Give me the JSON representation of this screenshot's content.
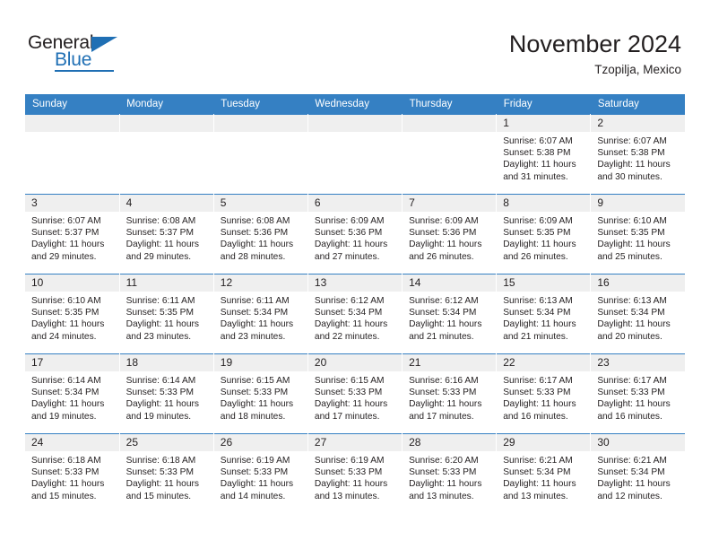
{
  "brand": {
    "name_top": "General",
    "name_bottom": "Blue",
    "accent_color": "#1f6fb4"
  },
  "header": {
    "title": "November 2024",
    "location": "Tzopilja, Mexico"
  },
  "theme": {
    "header_row_bg": "#3580c3",
    "day_number_bg": "#efefef",
    "text_color": "#231f20"
  },
  "weekdays": [
    "Sunday",
    "Monday",
    "Tuesday",
    "Wednesday",
    "Thursday",
    "Friday",
    "Saturday"
  ],
  "weeks": [
    [
      {
        "day": "",
        "empty": true
      },
      {
        "day": "",
        "empty": true
      },
      {
        "day": "",
        "empty": true
      },
      {
        "day": "",
        "empty": true
      },
      {
        "day": "",
        "empty": true
      },
      {
        "day": "1",
        "sunrise": "Sunrise: 6:07 AM",
        "sunset": "Sunset: 5:38 PM",
        "daylight1": "Daylight: 11 hours",
        "daylight2": "and 31 minutes."
      },
      {
        "day": "2",
        "sunrise": "Sunrise: 6:07 AM",
        "sunset": "Sunset: 5:38 PM",
        "daylight1": "Daylight: 11 hours",
        "daylight2": "and 30 minutes."
      }
    ],
    [
      {
        "day": "3",
        "sunrise": "Sunrise: 6:07 AM",
        "sunset": "Sunset: 5:37 PM",
        "daylight1": "Daylight: 11 hours",
        "daylight2": "and 29 minutes."
      },
      {
        "day": "4",
        "sunrise": "Sunrise: 6:08 AM",
        "sunset": "Sunset: 5:37 PM",
        "daylight1": "Daylight: 11 hours",
        "daylight2": "and 29 minutes."
      },
      {
        "day": "5",
        "sunrise": "Sunrise: 6:08 AM",
        "sunset": "Sunset: 5:36 PM",
        "daylight1": "Daylight: 11 hours",
        "daylight2": "and 28 minutes."
      },
      {
        "day": "6",
        "sunrise": "Sunrise: 6:09 AM",
        "sunset": "Sunset: 5:36 PM",
        "daylight1": "Daylight: 11 hours",
        "daylight2": "and 27 minutes."
      },
      {
        "day": "7",
        "sunrise": "Sunrise: 6:09 AM",
        "sunset": "Sunset: 5:36 PM",
        "daylight1": "Daylight: 11 hours",
        "daylight2": "and 26 minutes."
      },
      {
        "day": "8",
        "sunrise": "Sunrise: 6:09 AM",
        "sunset": "Sunset: 5:35 PM",
        "daylight1": "Daylight: 11 hours",
        "daylight2": "and 26 minutes."
      },
      {
        "day": "9",
        "sunrise": "Sunrise: 6:10 AM",
        "sunset": "Sunset: 5:35 PM",
        "daylight1": "Daylight: 11 hours",
        "daylight2": "and 25 minutes."
      }
    ],
    [
      {
        "day": "10",
        "sunrise": "Sunrise: 6:10 AM",
        "sunset": "Sunset: 5:35 PM",
        "daylight1": "Daylight: 11 hours",
        "daylight2": "and 24 minutes."
      },
      {
        "day": "11",
        "sunrise": "Sunrise: 6:11 AM",
        "sunset": "Sunset: 5:35 PM",
        "daylight1": "Daylight: 11 hours",
        "daylight2": "and 23 minutes."
      },
      {
        "day": "12",
        "sunrise": "Sunrise: 6:11 AM",
        "sunset": "Sunset: 5:34 PM",
        "daylight1": "Daylight: 11 hours",
        "daylight2": "and 23 minutes."
      },
      {
        "day": "13",
        "sunrise": "Sunrise: 6:12 AM",
        "sunset": "Sunset: 5:34 PM",
        "daylight1": "Daylight: 11 hours",
        "daylight2": "and 22 minutes."
      },
      {
        "day": "14",
        "sunrise": "Sunrise: 6:12 AM",
        "sunset": "Sunset: 5:34 PM",
        "daylight1": "Daylight: 11 hours",
        "daylight2": "and 21 minutes."
      },
      {
        "day": "15",
        "sunrise": "Sunrise: 6:13 AM",
        "sunset": "Sunset: 5:34 PM",
        "daylight1": "Daylight: 11 hours",
        "daylight2": "and 21 minutes."
      },
      {
        "day": "16",
        "sunrise": "Sunrise: 6:13 AM",
        "sunset": "Sunset: 5:34 PM",
        "daylight1": "Daylight: 11 hours",
        "daylight2": "and 20 minutes."
      }
    ],
    [
      {
        "day": "17",
        "sunrise": "Sunrise: 6:14 AM",
        "sunset": "Sunset: 5:34 PM",
        "daylight1": "Daylight: 11 hours",
        "daylight2": "and 19 minutes."
      },
      {
        "day": "18",
        "sunrise": "Sunrise: 6:14 AM",
        "sunset": "Sunset: 5:33 PM",
        "daylight1": "Daylight: 11 hours",
        "daylight2": "and 19 minutes."
      },
      {
        "day": "19",
        "sunrise": "Sunrise: 6:15 AM",
        "sunset": "Sunset: 5:33 PM",
        "daylight1": "Daylight: 11 hours",
        "daylight2": "and 18 minutes."
      },
      {
        "day": "20",
        "sunrise": "Sunrise: 6:15 AM",
        "sunset": "Sunset: 5:33 PM",
        "daylight1": "Daylight: 11 hours",
        "daylight2": "and 17 minutes."
      },
      {
        "day": "21",
        "sunrise": "Sunrise: 6:16 AM",
        "sunset": "Sunset: 5:33 PM",
        "daylight1": "Daylight: 11 hours",
        "daylight2": "and 17 minutes."
      },
      {
        "day": "22",
        "sunrise": "Sunrise: 6:17 AM",
        "sunset": "Sunset: 5:33 PM",
        "daylight1": "Daylight: 11 hours",
        "daylight2": "and 16 minutes."
      },
      {
        "day": "23",
        "sunrise": "Sunrise: 6:17 AM",
        "sunset": "Sunset: 5:33 PM",
        "daylight1": "Daylight: 11 hours",
        "daylight2": "and 16 minutes."
      }
    ],
    [
      {
        "day": "24",
        "sunrise": "Sunrise: 6:18 AM",
        "sunset": "Sunset: 5:33 PM",
        "daylight1": "Daylight: 11 hours",
        "daylight2": "and 15 minutes."
      },
      {
        "day": "25",
        "sunrise": "Sunrise: 6:18 AM",
        "sunset": "Sunset: 5:33 PM",
        "daylight1": "Daylight: 11 hours",
        "daylight2": "and 15 minutes."
      },
      {
        "day": "26",
        "sunrise": "Sunrise: 6:19 AM",
        "sunset": "Sunset: 5:33 PM",
        "daylight1": "Daylight: 11 hours",
        "daylight2": "and 14 minutes."
      },
      {
        "day": "27",
        "sunrise": "Sunrise: 6:19 AM",
        "sunset": "Sunset: 5:33 PM",
        "daylight1": "Daylight: 11 hours",
        "daylight2": "and 13 minutes."
      },
      {
        "day": "28",
        "sunrise": "Sunrise: 6:20 AM",
        "sunset": "Sunset: 5:33 PM",
        "daylight1": "Daylight: 11 hours",
        "daylight2": "and 13 minutes."
      },
      {
        "day": "29",
        "sunrise": "Sunrise: 6:21 AM",
        "sunset": "Sunset: 5:34 PM",
        "daylight1": "Daylight: 11 hours",
        "daylight2": "and 13 minutes."
      },
      {
        "day": "30",
        "sunrise": "Sunrise: 6:21 AM",
        "sunset": "Sunset: 5:34 PM",
        "daylight1": "Daylight: 11 hours",
        "daylight2": "and 12 minutes."
      }
    ]
  ]
}
